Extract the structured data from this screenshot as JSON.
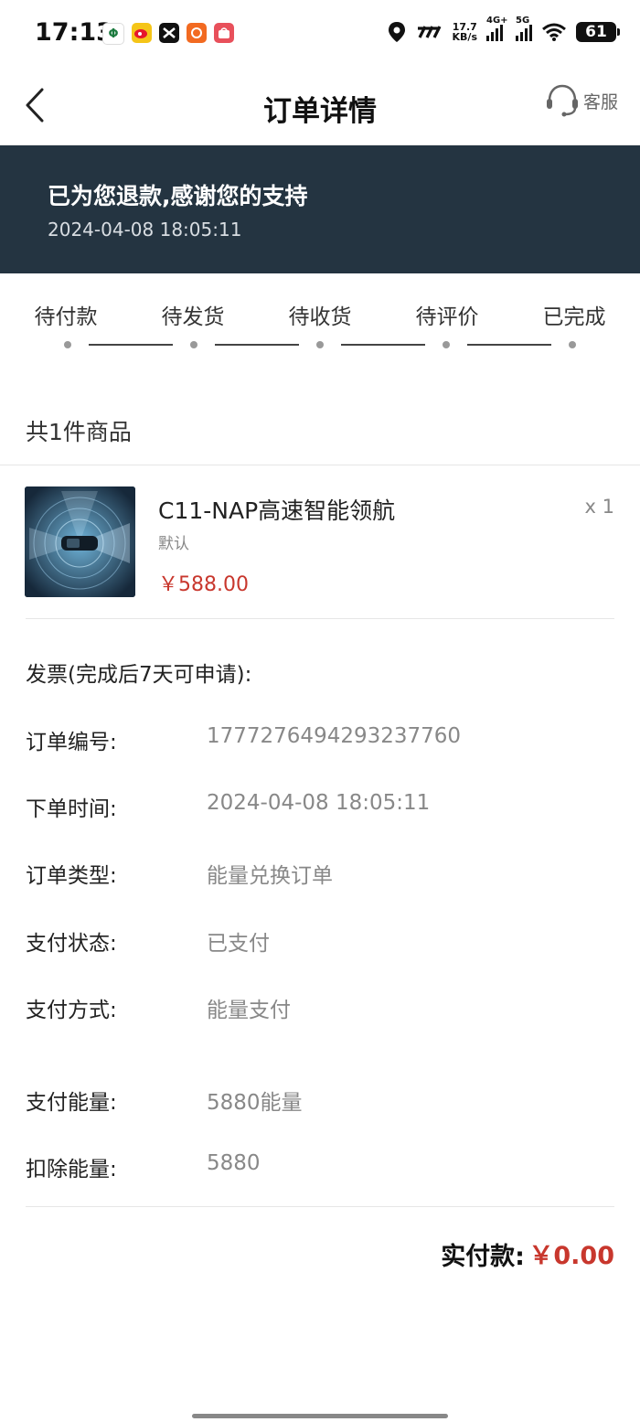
{
  "status_bar": {
    "time": "17:13",
    "net_speed_value": "17.7",
    "net_speed_unit": "KB/s",
    "signal1_label": "4G+",
    "signal2_label": "5G",
    "battery": "61"
  },
  "header": {
    "title": "订单详情",
    "customer_service": "客服"
  },
  "banner": {
    "message": "已为您退款,感谢您的支持",
    "time": "2024-04-08 18:05:11"
  },
  "steps": [
    "待付款",
    "待发货",
    "待收货",
    "待评价",
    "已完成"
  ],
  "product_section": {
    "count_label": "共1件商品",
    "name": "C11-NAP高速智能领航",
    "spec": "默认",
    "price": "￥588.00",
    "quantity": "x 1"
  },
  "invoice_label": "发票(完成后7天可申请):",
  "details": [
    {
      "label": "订单编号:",
      "value": "1777276494293237760"
    },
    {
      "label": "下单时间:",
      "value": "2024-04-08 18:05:11"
    },
    {
      "label": "订单类型:",
      "value": "能量兑换订单"
    },
    {
      "label": "支付状态:",
      "value": "已支付"
    },
    {
      "label": "支付方式:",
      "value": "能量支付"
    },
    {
      "label": "支付能量:",
      "value": "5880能量"
    },
    {
      "label": "扣除能量:",
      "value": "5880"
    }
  ],
  "total": {
    "label": "实付款:",
    "value": "￥0.00"
  },
  "colors": {
    "banner_bg": "#243441",
    "price_red": "#c8372d"
  }
}
